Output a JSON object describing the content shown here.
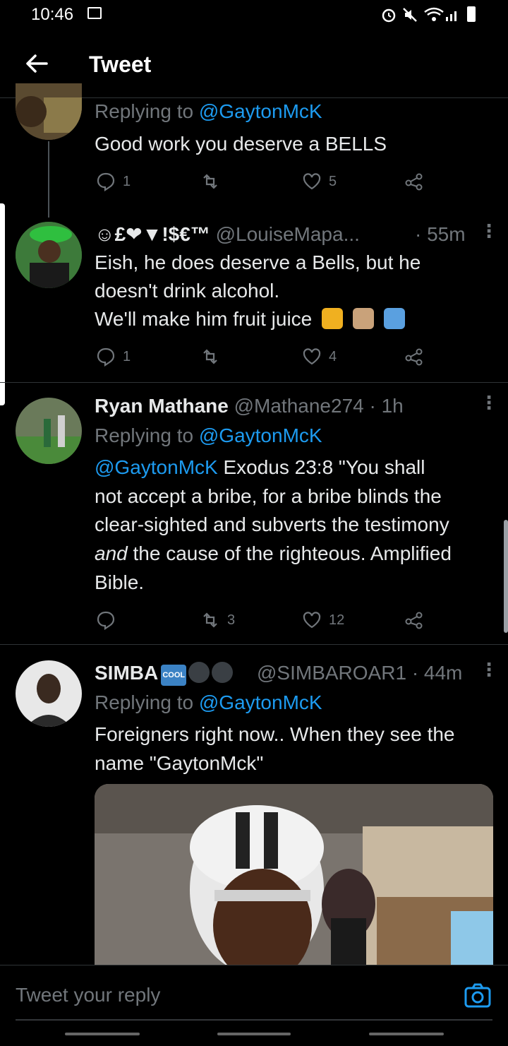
{
  "status_bar": {
    "time": "10:46"
  },
  "header": {
    "title": "Tweet"
  },
  "tweets": [
    {
      "replying_prefix": "Replying to ",
      "replying_to": "@GaytonMcK",
      "text": "Good work you deserve a BELLS",
      "replies": "1",
      "retweets": "",
      "likes": "5"
    },
    {
      "name": "☺£❤▼!$€™",
      "handle": "@LouiseMapa...",
      "time": "· 55m",
      "lines": [
        "Eish, he does deserve a Bells, but he",
        "doesn't drink alcohol.",
        "We'll make him fruit juice"
      ],
      "replies": "1",
      "retweets": "",
      "likes": "4"
    },
    {
      "name": "Ryan Mathane",
      "handle": "@Mathane274",
      "time": "· 1h",
      "replying_prefix": "Replying to ",
      "replying_to": "@GaytonMcK",
      "mention": "@GaytonMcK",
      "line1_rest": " Exodus 23:8 \"You shall",
      "line2": "not accept a bribe, for a bribe blinds the",
      "line3": "clear-sighted and subverts the testimony",
      "line4_italic": "and",
      "line4_rest": " the cause of the righteous. Amplified",
      "line5": "Bible.",
      "replies": "",
      "retweets": "3",
      "likes": "12"
    },
    {
      "name": "SIMBA",
      "badge": "COOL",
      "handle": "@SIMBAROAR1",
      "time": "· 44m",
      "replying_prefix": "Replying to ",
      "replying_to": "@GaytonMcK",
      "lines": [
        "Foreigners right now.. When they see the",
        "name \"GaytonMck\""
      ]
    }
  ],
  "reply_bar": {
    "placeholder": "Tweet your reply"
  },
  "colors": {
    "accent": "#1d9bf0",
    "like_heart": "#e0245e",
    "background": "#000000",
    "muted": "#71767b"
  }
}
